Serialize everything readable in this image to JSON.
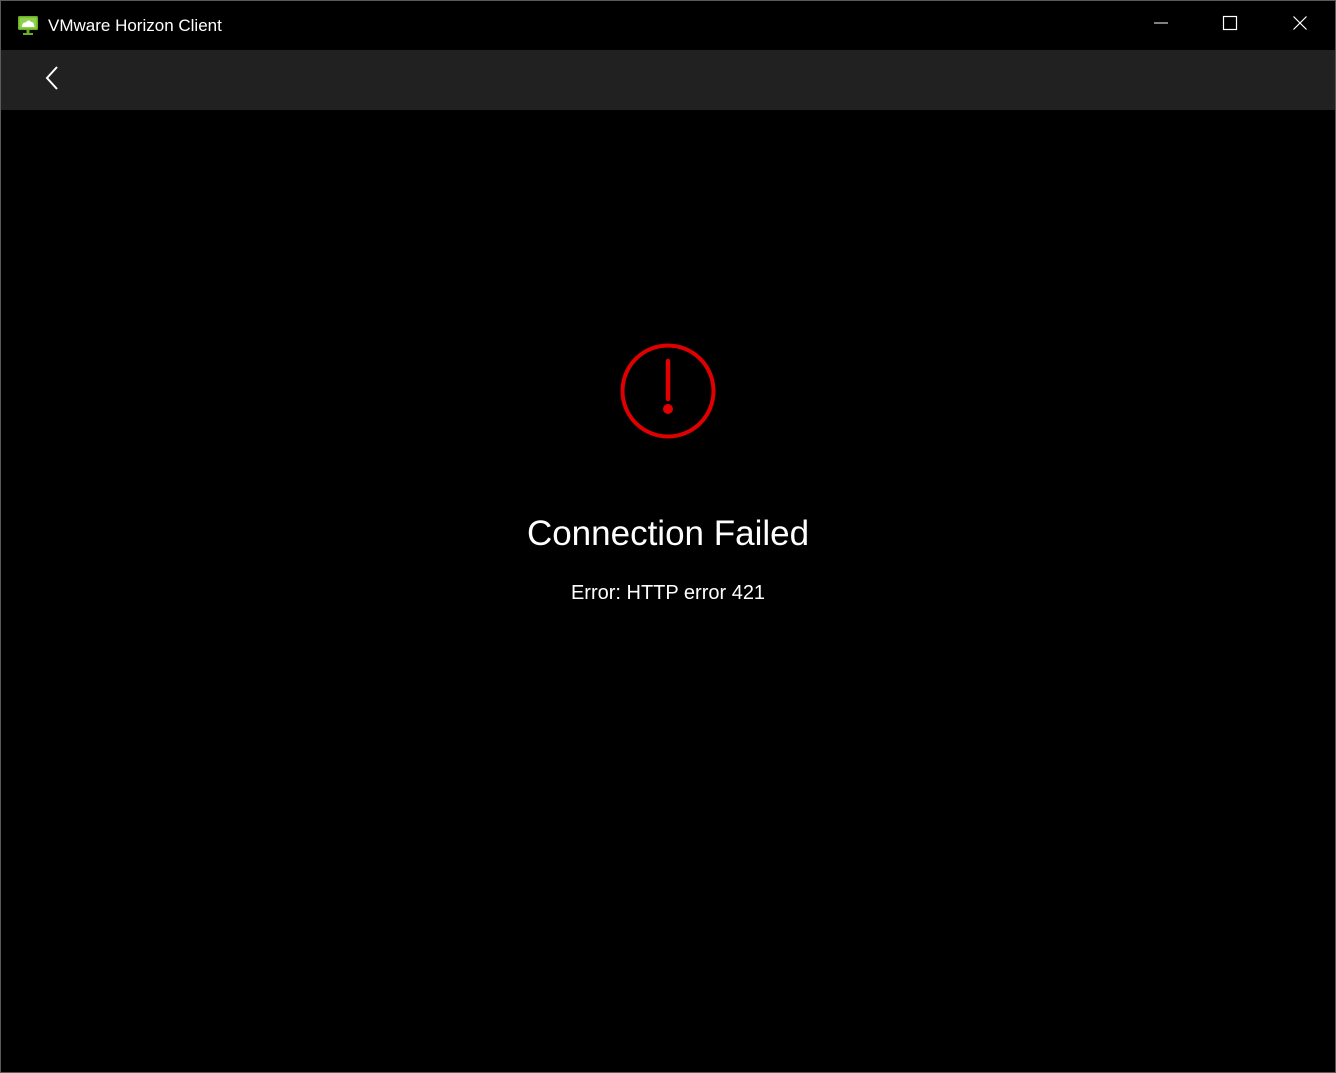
{
  "window": {
    "title": "VMware Horizon Client",
    "app_icon": "vmware-horizon-icon",
    "controls": {
      "minimize_icon": "minimize-icon",
      "maximize_icon": "maximize-icon",
      "close_icon": "close-icon"
    }
  },
  "navbar": {
    "back_icon": "chevron-left-icon"
  },
  "main": {
    "status_icon": "error-exclamation-icon",
    "title": "Connection Failed",
    "message": "Error: HTTP error 421"
  },
  "colors": {
    "background": "#000000",
    "navbar": "#212121",
    "error_red": "#e00000",
    "text": "#ffffff",
    "icon_green": "#6ab023"
  }
}
